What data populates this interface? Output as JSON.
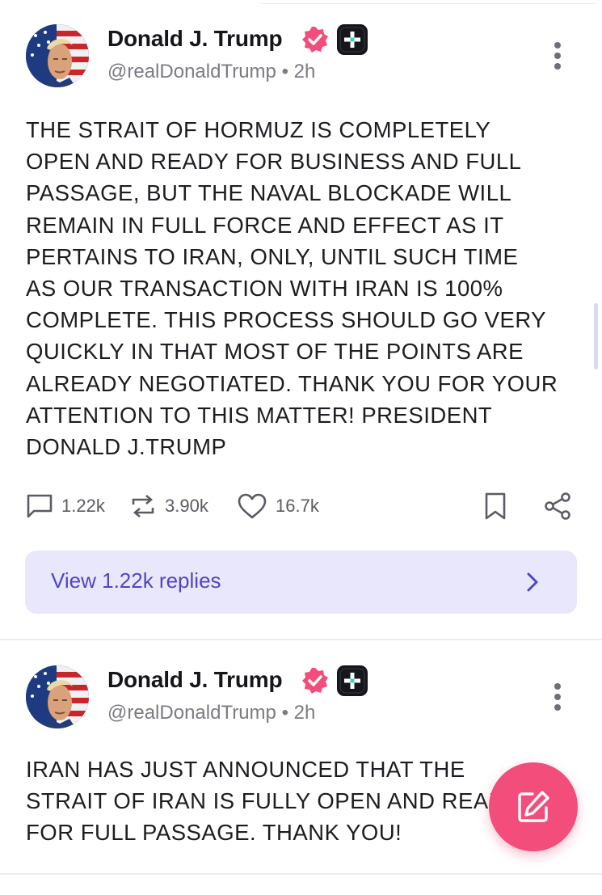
{
  "posts": [
    {
      "author": {
        "name": "Donald J. Trump",
        "handle": "@realDonaldTrump",
        "time": "2h",
        "verified_badge": "verified-check-badge",
        "plus_badge": "plus-badge"
      },
      "text": "THE STRAIT OF HORMUZ IS COMPLETELY\nOPEN AND READY FOR BUSINESS AND FULL\nPASSAGE, BUT THE NAVAL BLOCKADE WILL\nREMAIN IN FULL FORCE AND EFFECT AS IT\nPERTAINS TO IRAN, ONLY, UNTIL SUCH TIME\nAS OUR TRANSACTION WITH IRAN IS 100%\nCOMPLETE. THIS PROCESS SHOULD GO VERY\nQUICKLY IN THAT MOST OF THE POINTS ARE\nALREADY NEGOTIATED. THANK YOU FOR YOUR\nATTENTION TO THIS MATTER! PRESIDENT\nDONALD J.TRUMP",
      "stats": {
        "replies": "1.22k",
        "reposts": "3.90k",
        "likes": "16.7k"
      },
      "replies_link": "View 1.22k replies"
    },
    {
      "author": {
        "name": "Donald J. Trump",
        "handle": "@realDonaldTrump",
        "time": "2h",
        "verified_badge": "verified-check-badge",
        "plus_badge": "plus-badge"
      },
      "text": "IRAN HAS JUST ANNOUNCED THAT THE\nSTRAIT OF IRAN IS FULLY OPEN AND READY\nFOR FULL PASSAGE. THANK YOU!"
    }
  ],
  "colors": {
    "accent": "#f24d7b",
    "link": "#5145c7",
    "replies_bg": "#e8e7fb",
    "verified": "#f24d7b"
  },
  "icons": {
    "reply": "comment-icon",
    "repost": "repost-icon",
    "like": "heart-icon",
    "bookmark": "bookmark-icon",
    "share": "share-icon",
    "more": "more-vertical-icon",
    "compose": "compose-icon",
    "chevron": "chevron-right-icon"
  }
}
